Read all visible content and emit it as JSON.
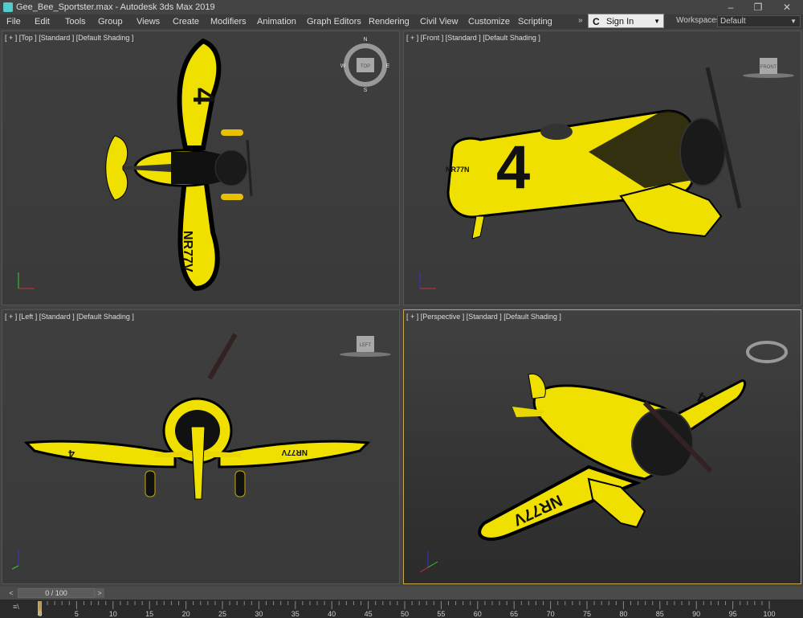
{
  "window": {
    "title": "Gee_Bee_Sportster.max - Autodesk 3ds Max 2019",
    "controls": {
      "minimize": "–",
      "maximize": "❐",
      "close": "✕"
    }
  },
  "menu": [
    "File",
    "Edit",
    "Tools",
    "Group",
    "Views",
    "Create",
    "Modifiers",
    "Animation",
    "Graph Editors",
    "Rendering",
    "Civil View",
    "Customize",
    "Scripting"
  ],
  "signin": {
    "label": "Sign In",
    "icon": "C"
  },
  "workspaces": {
    "label": "Workspaces:",
    "value": "Default"
  },
  "viewports": {
    "top": {
      "label": "[ + ] [Top ] [Standard ] [Default Shading ]",
      "cube": "TOP"
    },
    "front": {
      "label": "[ + ] [Front ] [Standard ] [Default Shading ]",
      "cube": "FRONT"
    },
    "left": {
      "label": "[ + ] [Left ] [Standard ] [Default Shading ]",
      "cube": "LEFT"
    },
    "perspective": {
      "label": "[ + ] [Perspective ] [Standard ] [Default Shading ]"
    }
  },
  "plane": {
    "number": "4",
    "registration": "NR77V",
    "registration_alt": "NR77N"
  },
  "compass": {
    "n": "N",
    "s": "S",
    "w": "W",
    "e": "E"
  },
  "timeline": {
    "frame": "0 / 100",
    "prev": "<",
    "next": ">"
  },
  "ruler": {
    "ticks": [
      "0",
      "5",
      "10",
      "15",
      "20",
      "25",
      "30",
      "35",
      "40",
      "45",
      "50",
      "55",
      "60",
      "65",
      "70",
      "75",
      "80",
      "85",
      "90",
      "95",
      "100"
    ]
  },
  "colors": {
    "accent": "#c8a84a",
    "plane_yellow": "#f0e000",
    "plane_black": "#111111"
  }
}
